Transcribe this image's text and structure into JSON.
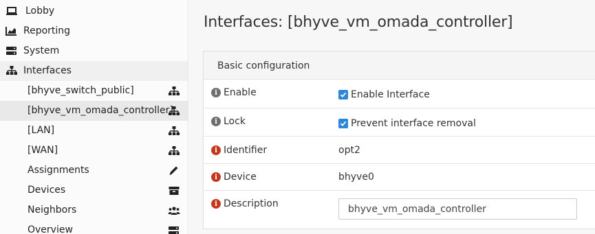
{
  "sidebar": {
    "top_items": [
      {
        "label": "Lobby",
        "icon": "laptop-icon"
      },
      {
        "label": "Reporting",
        "icon": "area-chart-icon"
      },
      {
        "label": "System",
        "icon": "server-icon"
      },
      {
        "label": "Interfaces",
        "icon": "sitemap-icon"
      }
    ],
    "sub_items": [
      {
        "label": "[bhyve_switch_public]",
        "icon": "sitemap-icon"
      },
      {
        "label": "[bhyve_vm_omada_controller]",
        "icon": "sitemap-icon"
      },
      {
        "label": "[LAN]",
        "icon": "sitemap-icon"
      },
      {
        "label": "[WAN]",
        "icon": "sitemap-icon"
      },
      {
        "label": "Assignments",
        "icon": "pencil-icon"
      },
      {
        "label": "Devices",
        "icon": "archive-icon"
      },
      {
        "label": "Neighbors",
        "icon": "users-icon"
      },
      {
        "label": "Overview",
        "icon": "server-icon"
      }
    ]
  },
  "main": {
    "title": "Interfaces: [bhyve_vm_omada_controller]",
    "section": {
      "header": "Basic configuration",
      "rows": [
        {
          "label": "Enable",
          "value": "Enable Interface",
          "checked": true
        },
        {
          "label": "Lock",
          "value": "Prevent interface removal",
          "checked": true
        },
        {
          "label": "Identifier",
          "value": "opt2"
        },
        {
          "label": "Device",
          "value": "bhyve0"
        },
        {
          "label": "Description",
          "value": "bhyve_vm_omada_controller"
        }
      ]
    }
  },
  "colors": {
    "accent": "#2f86d6",
    "info_red": "#c5381e",
    "info_grey": "#6f6f6f"
  }
}
